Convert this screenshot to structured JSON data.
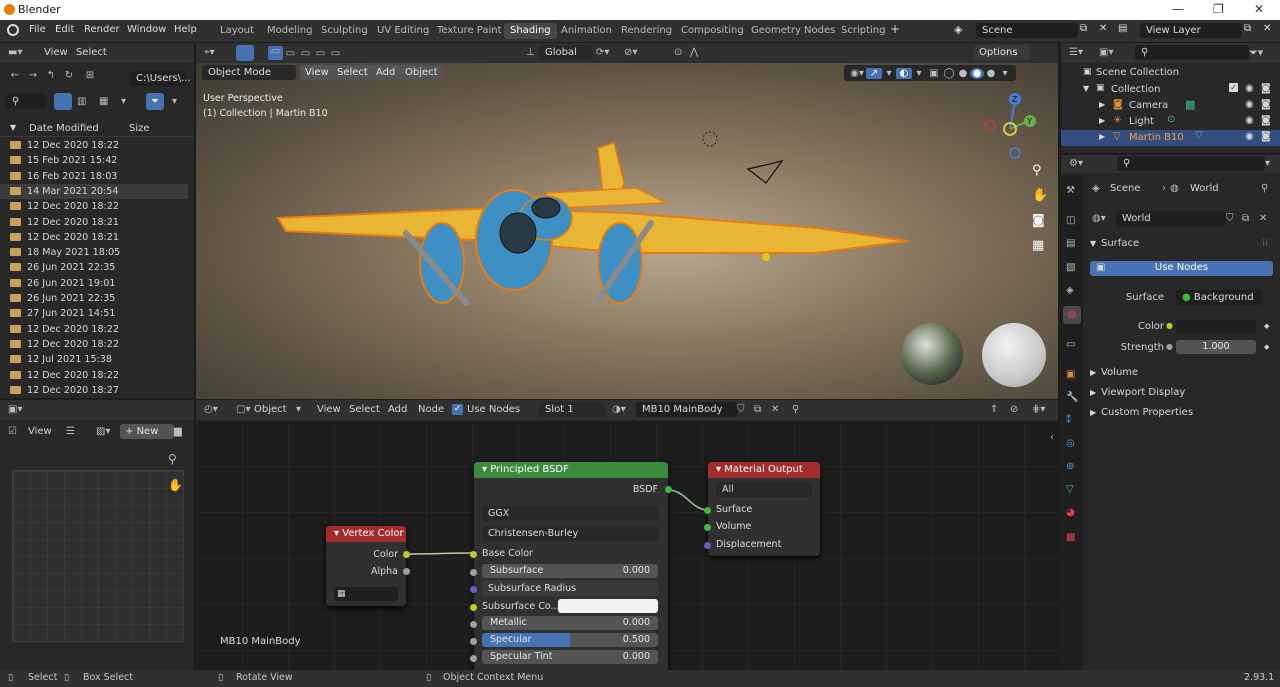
{
  "window": {
    "title": "Blender",
    "min": "—",
    "max": "❐",
    "close": "✕"
  },
  "menu": [
    "File",
    "Edit",
    "Render",
    "Window",
    "Help"
  ],
  "workspaces": [
    "Layout",
    "Modeling",
    "Sculpting",
    "UV Editing",
    "Texture Paint",
    "Shading",
    "Animation",
    "Rendering",
    "Compositing",
    "Geometry Nodes",
    "Scripting"
  ],
  "active_workspace": "Shading",
  "scene_name": "Scene",
  "view_layer": "View Layer",
  "file_browser": {
    "menu": [
      "View",
      "Select"
    ],
    "path": "C:\\Users\\...",
    "col_date": "Date Modified",
    "col_size": "Size",
    "rows": [
      "12 Dec 2020 18:22",
      "15 Feb 2021 15:42",
      "16 Feb 2021 18:03",
      "14 Mar 2021 20:54",
      "12 Dec 2020 18:22",
      "12 Dec 2020 18:21",
      "12 Dec 2020 18:21",
      "18 May 2021 18:05",
      "26 Jun 2021 22:35",
      "26 Jun 2021 19:01",
      "26 Jun 2021 22:35",
      "27 Jun 2021 14:51",
      "12 Dec 2020 18:22",
      "12 Dec 2020 18:22",
      "12 Jul 2021 15:38",
      "12 Dec 2020 18:22",
      "12 Dec 2020 18:27"
    ],
    "highlighted_index": 3
  },
  "viewport": {
    "mode": "Object Mode",
    "menu": [
      "View",
      "Select",
      "Add",
      "Object"
    ],
    "transform": "Global",
    "options": "Options",
    "overlay_line1": "User Perspective",
    "overlay_line2": "(1) Collection | Martin B10",
    "gizmo": {
      "z": "Z",
      "y": "Y"
    }
  },
  "node_editor": {
    "type": "Object",
    "menu": [
      "View",
      "Select",
      "Add",
      "Node"
    ],
    "use_nodes": "Use Nodes",
    "slot": "Slot 1",
    "material": "MB10 MainBody",
    "footer_label": "MB10 MainBody",
    "vertex_color": {
      "title": "Vertex Color",
      "out_color": "Color",
      "out_alpha": "Alpha"
    },
    "bsdf": {
      "title": "Principled BSDF",
      "out": "BSDF",
      "distribution": "GGX",
      "sss_method": "Christensen-Burley",
      "base_color": "Base Color",
      "subsurface_label": "Subsurface",
      "subsurface": "0.000",
      "subsurface_radius": "Subsurface Radius",
      "subsurface_color": "Subsurface Co...",
      "metallic_label": "Metallic",
      "metallic": "0.000",
      "specular_label": "Specular",
      "specular": "0.500",
      "specular_fraction": 0.5,
      "specular_tint_label": "Specular Tint",
      "specular_tint": "0.000"
    },
    "output": {
      "title": "Material Output",
      "target": "All",
      "surface": "Surface",
      "volume": "Volume",
      "displacement": "Displacement"
    }
  },
  "image_editor": {
    "view": "View",
    "new": "New"
  },
  "outliner": {
    "root": "Scene Collection",
    "items": [
      {
        "label": "Collection"
      },
      {
        "label": "Camera"
      },
      {
        "label": "Light"
      },
      {
        "label": "Martin B10"
      }
    ]
  },
  "properties": {
    "scene_tab": "Scene",
    "world_tab": "World",
    "world_name": "World",
    "surface_section": "Surface",
    "use_nodes": "Use Nodes",
    "surface_label": "Surface",
    "surface_value": "Background",
    "color_label": "Color",
    "strength_label": "Strength",
    "strength_value": "1.000",
    "sections": [
      "Volume",
      "Viewport Display",
      "Custom Properties"
    ]
  },
  "status": {
    "select": "Select",
    "box_select": "Box Select",
    "rotate": "Rotate View",
    "context": "Object Context Menu",
    "version": "2.93.1"
  },
  "colors": {
    "accent": "#4772b3",
    "bsdf_header": "#3c8b3c",
    "output_header": "#a32d2d",
    "vertex_header": "#a32d2d",
    "selected_orange": "#e87d0d"
  }
}
